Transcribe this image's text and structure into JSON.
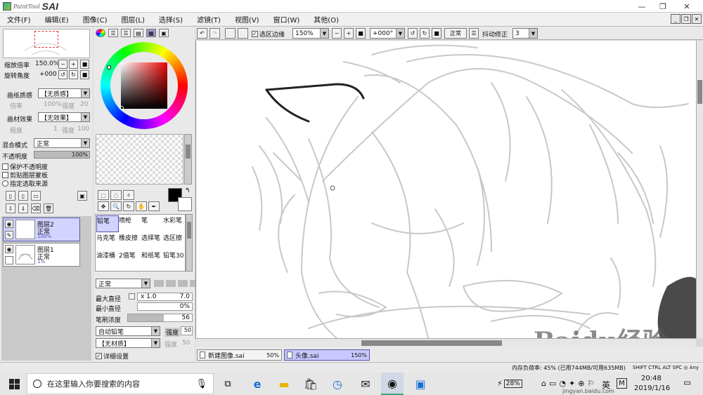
{
  "app": {
    "title_small": "PaintTool",
    "title_big": "SAI"
  },
  "menu": [
    "文件(F)",
    "编辑(E)",
    "图像(C)",
    "图层(L)",
    "选择(S)",
    "滤镜(T)",
    "视图(V)",
    "窗口(W)",
    "其他(O)"
  ],
  "navigator": {
    "zoom_label": "缩放倍率",
    "zoom_value": "150.0%",
    "rotate_label": "旋转角度",
    "rotate_value": "+000"
  },
  "paper": {
    "texture_label": "画纸质感",
    "texture_value": "【无质感】",
    "scale_label": "倍率",
    "scale_value": "100%",
    "strength_label": "强度",
    "strength_value": "20",
    "effect_label": "画材效果",
    "effect_value": "【无效果】",
    "degree_label": "程度",
    "degree_value": "1",
    "strength2_label": "强度",
    "strength2_value": "100"
  },
  "blend": {
    "mode_label": "混合模式",
    "mode_value": "正常",
    "opacity_label": "不透明度",
    "opacity_value": "100%",
    "protect": "保护不透明度",
    "clip": "剪贴图层蒙板",
    "source": "指定选取来源"
  },
  "layers": [
    {
      "name": "图层2",
      "mode": "正常",
      "opacity": "100%"
    },
    {
      "name": "图层1",
      "mode": "正常",
      "opacity": "1%"
    }
  ],
  "tools": [
    [
      "铅笔",
      "喷枪",
      "笔",
      "水彩笔"
    ],
    [
      "马克笔",
      "橡皮擦",
      "选择笔",
      "选区擦"
    ],
    [
      "油漆桶",
      "2值笔",
      "和纸笔",
      "铅笔30"
    ]
  ],
  "brush": {
    "mode": "正常",
    "max_label": "最大直径",
    "max_mult": "x 1.0",
    "max_value": "7.0",
    "min_label": "最小直径",
    "min_value": "0%",
    "density_label": "笔刷浓度",
    "density_value": "56",
    "density_fraction": 0.56,
    "type_value": "自动铅笔",
    "strength_label": "强度",
    "strength_value": "50",
    "material_value": "【无材质】",
    "material_strength_label": "强度",
    "material_strength_value": "50",
    "detail": "详细设置"
  },
  "toolbar": {
    "sel_edge": "选区边缘",
    "zoom": "150%",
    "angle": "+000°",
    "mode": "正常",
    "stab_label": "抖动修正",
    "stab_value": "3"
  },
  "tabs": [
    {
      "name": "新建图像.sai",
      "zoom": "50%"
    },
    {
      "name": "头像.sai",
      "zoom": "150%"
    }
  ],
  "status": {
    "memory": "内存负荷率: 45% (已用744MB/可用635MB)",
    "keys": "SHIFT CTRL ALT SPC ◎ Any"
  },
  "taskbar": {
    "search": "在这里输入你要搜索的内容",
    "battery": "28%",
    "ime": "英",
    "time": "20:48",
    "date": "2019/1/16"
  },
  "watermark": {
    "text": "Baidu经验",
    "url": "jingyan.baidu.com"
  }
}
